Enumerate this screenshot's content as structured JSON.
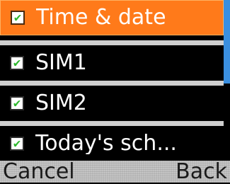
{
  "list": {
    "items": [
      {
        "label": "Time & date",
        "checked": true,
        "selected": true
      },
      {
        "label": "SIM1",
        "checked": true,
        "selected": false
      },
      {
        "label": "SIM2",
        "checked": true,
        "selected": false
      },
      {
        "label": "Today's sch...",
        "checked": true,
        "selected": false
      }
    ]
  },
  "checkmark_glyph": "✔",
  "softkeys": {
    "left": "Cancel",
    "right": "Back"
  },
  "colors": {
    "background": "#000000",
    "selected_row": "#ff7a1a",
    "separator": "#cfcfcf",
    "checkmark": "#2db82d",
    "scrollbar_thumb": "#3a8fe0",
    "softkey_bar": "#bdbdbd"
  }
}
